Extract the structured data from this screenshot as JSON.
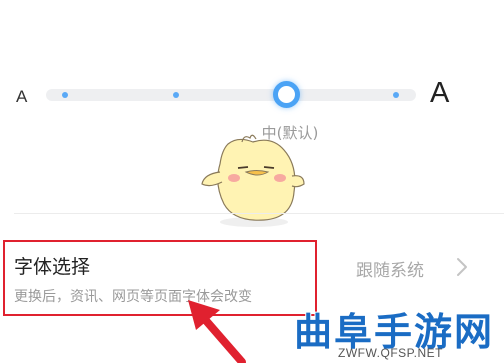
{
  "font_size": {
    "small_label": "A",
    "large_label": "A",
    "current_label": "中(默认)",
    "levels": 5,
    "selected_level": 4,
    "accent_color": "#4ba3f5"
  },
  "font_choice": {
    "title": "字体选择",
    "subtitle": "更换后，资讯、网页等页面字体会改变",
    "value": "跟随系统",
    "chevron_icon": "chevron-right-icon",
    "highlight_color": "#e0212f"
  },
  "mascot": {
    "icon": "yellow-chick-mascot"
  },
  "annotation": {
    "arrow_color": "#e0212f"
  },
  "watermark": {
    "logo_text": "曲阜手游网",
    "url": "ZWFW.QFSP.NET"
  }
}
